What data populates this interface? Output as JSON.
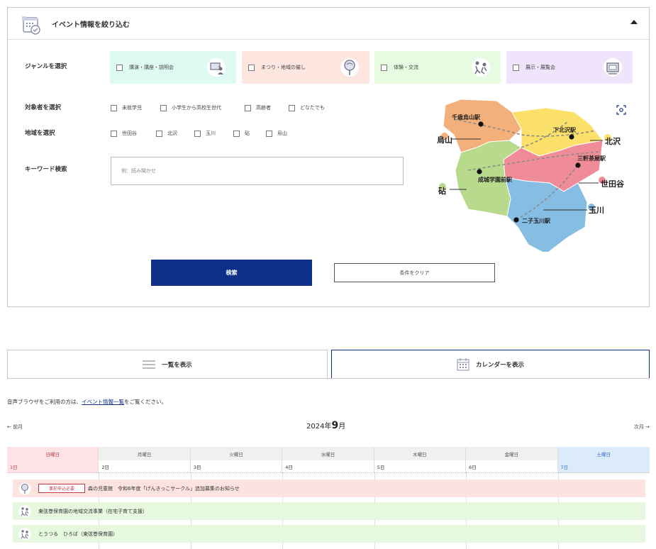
{
  "filter": {
    "title": "イベント情報を絞り込む",
    "genre_label": "ジャンルを選択",
    "genres": [
      {
        "label": "講演・講座・説明会",
        "bg": "#dffaf2"
      },
      {
        "label": "まつり・地域の催し",
        "bg": "#fde5e0"
      },
      {
        "label": "体験・交流",
        "bg": "#e6fbe0"
      },
      {
        "label": "展示・展覧会",
        "bg": "#efe4fb"
      }
    ],
    "target_label": "対象者を選択",
    "targets": [
      "未就学児",
      "小学生から高校生世代",
      "高齢者",
      "どなたでも"
    ],
    "area_label": "地域を選択",
    "areas": [
      "世田谷",
      "北沢",
      "玉川",
      "砧",
      "烏山"
    ],
    "keyword_label": "キーワード検索",
    "keyword_placeholder": "例：読み聞かせ",
    "search_button": "検索",
    "clear_button": "条件をクリア"
  },
  "map": {
    "stations": [
      "千歳烏山駅",
      "下北沢駅",
      "三軒茶屋駅",
      "成城学園前駅",
      "二子玉川駅"
    ],
    "areas": {
      "karasuyama": "烏山",
      "kitazawa": "北沢",
      "setagaya": "世田谷",
      "kinuta": "砧",
      "tamagawa": "玉川"
    },
    "colors": {
      "karasuyama": "#f3b07a",
      "kitazawa": "#fbe06a",
      "setagaya": "#ef8c98",
      "kinuta": "#b8da8c",
      "tamagawa": "#86bde3"
    }
  },
  "view_tabs": {
    "list": "一覧を表示",
    "calendar": "カレンダーを表示"
  },
  "notice": {
    "prefix": "音声ブラウザをご利用の方は、",
    "link": "イベント情報一覧",
    "suffix": "をご覧ください。"
  },
  "calendar": {
    "prev": "前月",
    "next": "次月",
    "year_label": "2024年",
    "month_num": "9",
    "month_unit": "月",
    "weekdays": [
      "日曜日",
      "月曜日",
      "火曜日",
      "水曜日",
      "木曜日",
      "金曜日",
      "土曜日"
    ],
    "dates": [
      "1日",
      "2日",
      "3日",
      "4日",
      "5日",
      "6日",
      "7日"
    ],
    "events": [
      {
        "badge": "事前申込必要",
        "title": "森の児童館　令和6年度「げんきっこサークル」追加募集のお知らせ",
        "genre": "festival"
      },
      {
        "badge": "",
        "title": "東弦巻保育園の地域交流事業（在宅子育て支援）",
        "genre": "experience"
      },
      {
        "badge": "",
        "title": "とうつる　ひろば（東弦巻保育園）",
        "genre": "experience"
      }
    ]
  }
}
